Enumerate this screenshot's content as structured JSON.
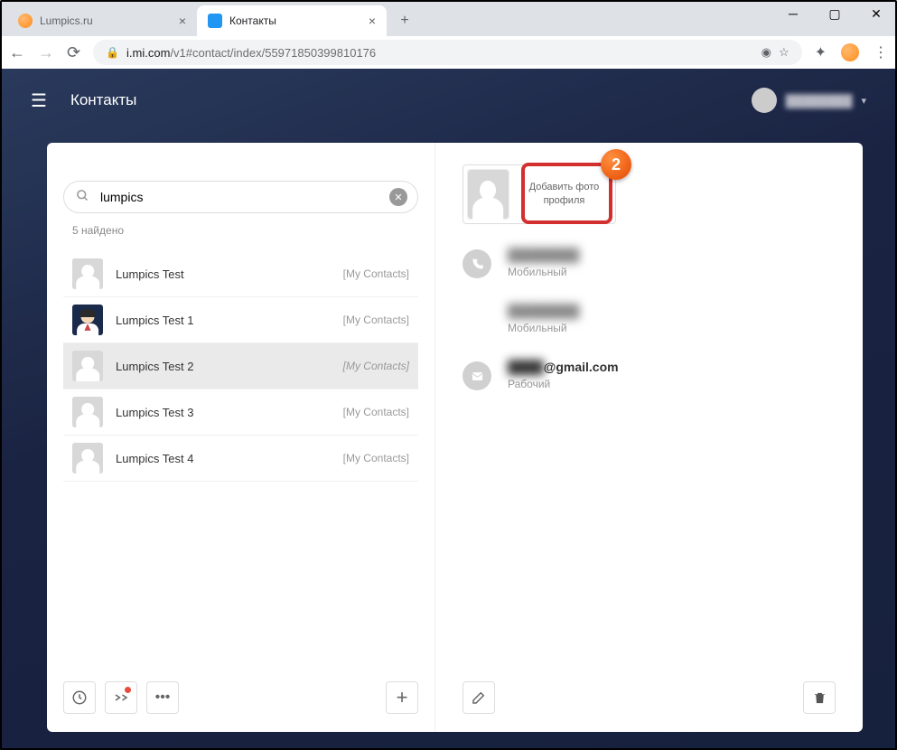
{
  "browser": {
    "tabs": [
      {
        "title": "Lumpics.ru",
        "active": false
      },
      {
        "title": "Контакты",
        "active": true
      }
    ],
    "url_domain": "i.mi.com",
    "url_path": "/v1#contact/index/55971850399810176"
  },
  "app": {
    "title": "Контакты",
    "user_name": "████████"
  },
  "search": {
    "value": "lumpics",
    "found_label": "5 найдено"
  },
  "contacts": [
    {
      "name": "Lumpics Test",
      "tag": "[My Contacts]",
      "avatar": "sil",
      "selected": false
    },
    {
      "name": "Lumpics Test 1",
      "tag": "[My Contacts]",
      "avatar": "cartoon",
      "selected": false
    },
    {
      "name": "Lumpics Test 2",
      "tag": "[My Contacts]",
      "avatar": "sil",
      "selected": true
    },
    {
      "name": "Lumpics Test 3",
      "tag": "[My Contacts]",
      "avatar": "sil",
      "selected": false
    },
    {
      "name": "Lumpics Test 4",
      "tag": "[My Contacts]",
      "avatar": "sil",
      "selected": false
    }
  ],
  "profile": {
    "add_photo_label": "Добавить фото профиля",
    "badge_number": "2"
  },
  "details": {
    "phone1_value": "████████",
    "phone1_label": "Мобильный",
    "phone2_value": "████████",
    "phone2_label": "Мобильный",
    "email_suffix": "@gmail.com",
    "email_label": "Рабочий"
  }
}
